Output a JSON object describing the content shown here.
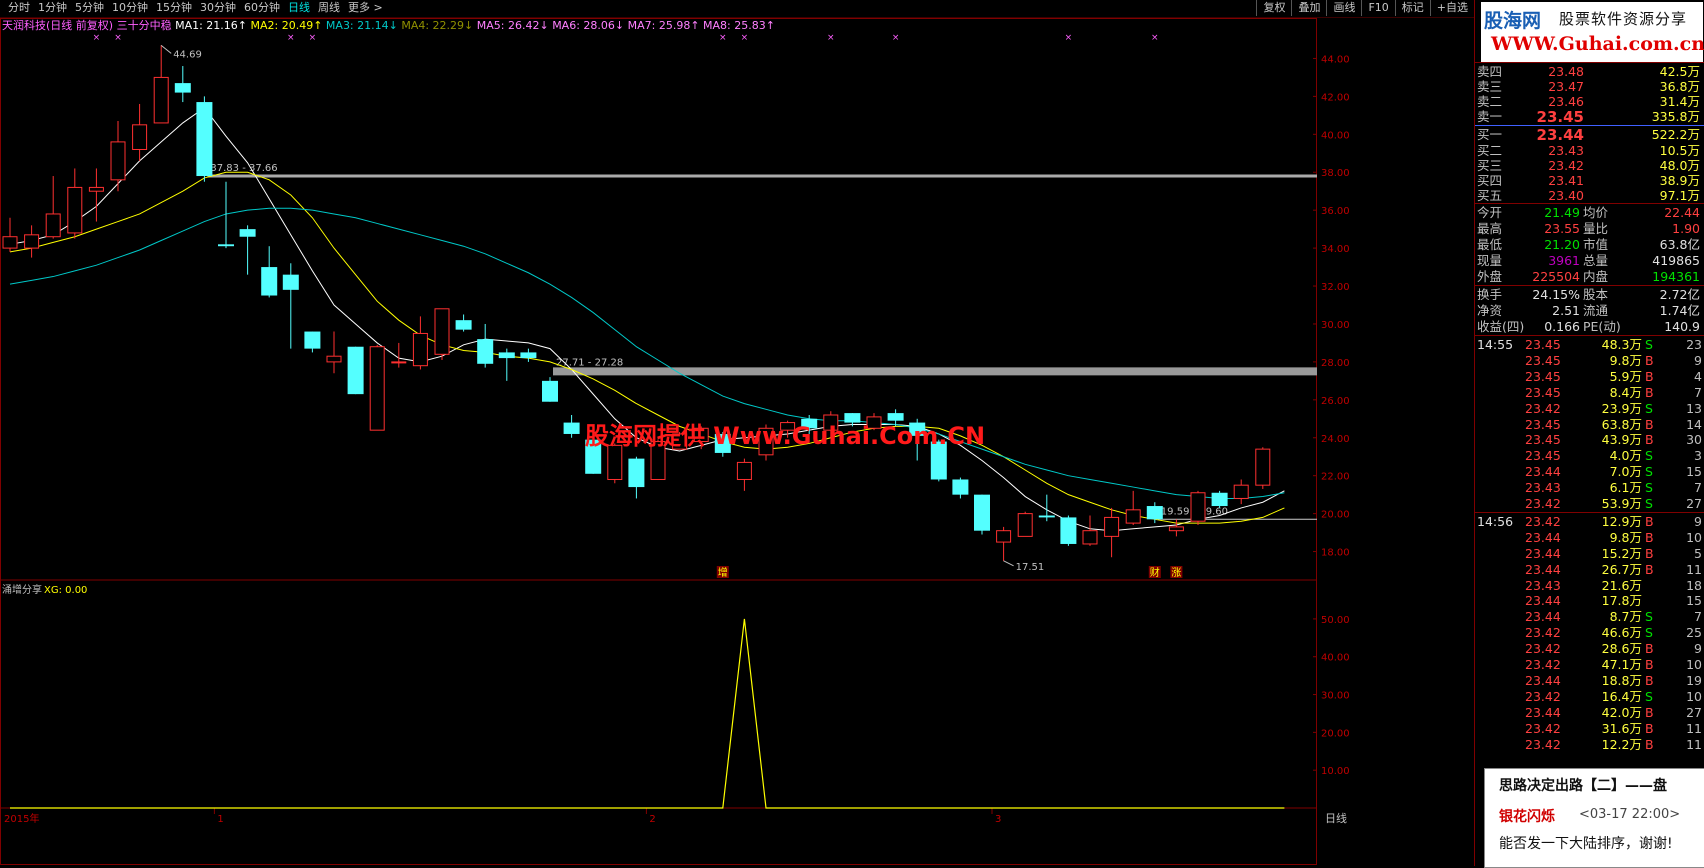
{
  "topbar": {
    "tabs": [
      "分时",
      "1分钟",
      "5分钟",
      "10分钟",
      "15分钟",
      "30分钟",
      "60分钟",
      "日线",
      "周线",
      "更多 >"
    ],
    "active": "日线",
    "right_buttons": [
      "复权",
      "叠加",
      "画线",
      "F10",
      "标记",
      "+自选"
    ]
  },
  "legend": {
    "title": "天润科技(日线 前复权) 三十分中稳",
    "ma": [
      {
        "name": "MA1",
        "value": "21.16",
        "arrow": "↑",
        "color": "#ffffff"
      },
      {
        "name": "MA2",
        "value": "20.49",
        "arrow": "↑",
        "color": "#ffff00"
      },
      {
        "name": "MA3",
        "value": "21.14",
        "arrow": "↓",
        "color": "#00c8c8"
      },
      {
        "name": "MA4",
        "value": "22.29",
        "arrow": "↓",
        "color": "#909000"
      },
      {
        "name": "MA5",
        "value": "26.42",
        "arrow": "↓",
        "color": "#ff80ff"
      },
      {
        "name": "MA6",
        "value": "28.06",
        "arrow": "↓",
        "color": "#ff80ff"
      },
      {
        "name": "MA7",
        "value": "25.98",
        "arrow": "↑",
        "color": "#ff80ff"
      },
      {
        "name": "MA8",
        "value": "25.83",
        "arrow": "↑",
        "color": "#ff80ff"
      }
    ]
  },
  "watermark": "股海网提供 Www.Guhai.Com.CN",
  "chart_data": [
    {
      "type": "candlestick",
      "ylim": [
        16.5,
        45.5
      ],
      "yticks": [
        "44.00",
        "42.00",
        "40.00",
        "38.00",
        "36.00",
        "34.00",
        "32.00",
        "30.00",
        "28.00",
        "26.00",
        "24.00",
        "22.00",
        "20.00",
        "18.00"
      ],
      "xtick_labels": [
        "2015年",
        "1",
        "2",
        "3"
      ],
      "xtick_index": [
        0,
        9,
        29,
        45
      ],
      "candles": [
        {
          "o": 34.0,
          "c": 34.6,
          "h": 35.6,
          "l": 33.8
        },
        {
          "o": 34.0,
          "c": 34.7,
          "h": 35.2,
          "l": 33.5
        },
        {
          "o": 34.6,
          "c": 35.8,
          "h": 37.8,
          "l": 34.5
        },
        {
          "o": 34.8,
          "c": 37.2,
          "h": 38.2,
          "l": 34.5
        },
        {
          "o": 37.0,
          "c": 37.2,
          "h": 38.2,
          "l": 35.4
        },
        {
          "o": 37.6,
          "c": 39.6,
          "h": 40.7,
          "l": 37.0
        },
        {
          "o": 39.2,
          "c": 40.5,
          "h": 41.6,
          "l": 38.6
        },
        {
          "o": 40.6,
          "c": 43.0,
          "h": 44.7,
          "l": 40.6
        },
        {
          "o": 42.7,
          "c": 42.2,
          "h": 43.6,
          "l": 41.7
        },
        {
          "o": 41.7,
          "c": 37.8,
          "h": 42.0,
          "l": 37.5
        },
        {
          "o": 34.2,
          "c": 34.1,
          "h": 37.5,
          "l": 34.0
        },
        {
          "o": 35.0,
          "c": 34.6,
          "h": 35.2,
          "l": 32.6
        },
        {
          "o": 33.0,
          "c": 31.5,
          "h": 34.1,
          "l": 31.4
        },
        {
          "o": 32.6,
          "c": 31.8,
          "h": 33.2,
          "l": 28.7
        },
        {
          "o": 29.6,
          "c": 28.7,
          "h": 29.6,
          "l": 28.5
        },
        {
          "o": 28.0,
          "c": 28.3,
          "h": 29.6,
          "l": 27.4
        },
        {
          "o": 28.8,
          "c": 26.3,
          "h": 28.8,
          "l": 26.3
        },
        {
          "o": 24.4,
          "c": 28.8,
          "h": 28.9,
          "l": 24.4
        },
        {
          "o": 28.0,
          "c": 28.0,
          "h": 29.0,
          "l": 27.7
        },
        {
          "o": 27.8,
          "c": 29.5,
          "h": 30.4,
          "l": 27.6
        },
        {
          "o": 28.4,
          "c": 30.8,
          "h": 30.8,
          "l": 28.1
        },
        {
          "o": 30.2,
          "c": 29.7,
          "h": 30.5,
          "l": 29.6
        },
        {
          "o": 29.2,
          "c": 27.9,
          "h": 30.0,
          "l": 27.7
        },
        {
          "o": 28.5,
          "c": 28.2,
          "h": 28.7,
          "l": 27.0
        },
        {
          "o": 28.5,
          "c": 28.2,
          "h": 28.7,
          "l": 28.0
        },
        {
          "o": 27.0,
          "c": 25.9,
          "h": 27.2,
          "l": 25.9
        },
        {
          "o": 24.8,
          "c": 24.2,
          "h": 25.2,
          "l": 24.0
        },
        {
          "o": 23.9,
          "c": 22.1,
          "h": 24.0,
          "l": 22.1
        },
        {
          "o": 21.8,
          "c": 23.6,
          "h": 23.7,
          "l": 21.6
        },
        {
          "o": 22.9,
          "c": 21.4,
          "h": 23.0,
          "l": 20.8
        },
        {
          "o": 21.8,
          "c": 23.8,
          "h": 23.9,
          "l": 21.8
        },
        {
          "o": 23.4,
          "c": 24.2,
          "h": 24.3,
          "l": 23.4
        },
        {
          "o": 23.8,
          "c": 24.5,
          "h": 24.6,
          "l": 23.4
        },
        {
          "o": 24.2,
          "c": 23.2,
          "h": 24.3,
          "l": 23.0
        },
        {
          "o": 21.8,
          "c": 22.7,
          "h": 22.9,
          "l": 21.2
        },
        {
          "o": 23.1,
          "c": 24.5,
          "h": 24.7,
          "l": 22.8
        },
        {
          "o": 24.4,
          "c": 24.8,
          "h": 24.9,
          "l": 24.0
        },
        {
          "o": 25.0,
          "c": 24.5,
          "h": 25.2,
          "l": 24.2
        },
        {
          "o": 24.4,
          "c": 25.2,
          "h": 25.4,
          "l": 24.0
        },
        {
          "o": 25.3,
          "c": 24.8,
          "h": 25.3,
          "l": 24.6
        },
        {
          "o": 24.5,
          "c": 25.1,
          "h": 25.3,
          "l": 24.4
        },
        {
          "o": 25.3,
          "c": 24.9,
          "h": 25.5,
          "l": 24.6
        },
        {
          "o": 24.8,
          "c": 24.1,
          "h": 25.0,
          "l": 22.8
        },
        {
          "o": 23.8,
          "c": 21.8,
          "h": 23.9,
          "l": 21.7
        },
        {
          "o": 21.8,
          "c": 21.0,
          "h": 21.9,
          "l": 20.8
        },
        {
          "o": 21.0,
          "c": 19.1,
          "h": 21.0,
          "l": 18.9
        },
        {
          "o": 18.5,
          "c": 19.1,
          "h": 19.3,
          "l": 17.5
        },
        {
          "o": 18.8,
          "c": 20.0,
          "h": 20.1,
          "l": 18.8
        },
        {
          "o": 19.9,
          "c": 19.8,
          "h": 21.0,
          "l": 19.6
        },
        {
          "o": 19.8,
          "c": 18.4,
          "h": 19.9,
          "l": 18.3
        },
        {
          "o": 18.4,
          "c": 19.1,
          "h": 19.9,
          "l": 18.3
        },
        {
          "o": 18.8,
          "c": 19.8,
          "h": 20.3,
          "l": 17.7
        },
        {
          "o": 19.5,
          "c": 20.2,
          "h": 21.2,
          "l": 19.4
        },
        {
          "o": 20.4,
          "c": 19.7,
          "h": 20.6,
          "l": 19.5
        },
        {
          "o": 19.1,
          "c": 19.3,
          "h": 19.7,
          "l": 18.8
        },
        {
          "o": 19.6,
          "c": 21.1,
          "h": 21.2,
          "l": 19.4
        },
        {
          "o": 21.1,
          "c": 20.4,
          "h": 21.2,
          "l": 20.3
        },
        {
          "o": 20.8,
          "c": 21.5,
          "h": 21.8,
          "l": 20.5
        },
        {
          "o": 21.5,
          "c": 23.4,
          "h": 23.5,
          "l": 21.3
        }
      ],
      "ma_lines": [
        {
          "name": "MA1",
          "color": "#ffffff",
          "values": [
            34.2,
            34.4,
            34.7,
            35.4,
            36.2,
            37.4,
            38.6,
            39.6,
            40.6,
            41.4,
            39.9,
            38.5,
            36.6,
            34.7,
            32.8,
            31.0,
            30.0,
            29.0,
            28.2,
            28.0,
            28.3,
            28.9,
            29.2,
            29.1,
            29.0,
            28.7,
            27.6,
            26.3,
            25.0,
            24.0,
            23.5,
            23.3,
            23.6,
            23.9,
            24.0,
            24.1,
            24.2,
            24.4,
            24.6,
            24.7,
            24.7,
            24.7,
            24.6,
            24.2,
            23.6,
            22.8,
            21.9,
            20.9,
            20.2,
            19.6,
            19.2,
            19.1,
            19.2,
            19.3,
            19.4,
            19.7,
            19.9,
            20.3,
            20.6,
            21.2
          ]
        },
        {
          "name": "MA2",
          "color": "#ffff00",
          "values": [
            33.8,
            34.0,
            34.3,
            34.6,
            35.0,
            35.4,
            35.8,
            36.4,
            37.0,
            37.7,
            38.0,
            38.0,
            37.6,
            36.8,
            35.6,
            34.0,
            32.6,
            31.2,
            30.2,
            29.4,
            28.9,
            28.6,
            28.5,
            28.3,
            28.2,
            28.0,
            27.6,
            27.1,
            26.5,
            25.8,
            25.2,
            24.6,
            24.2,
            23.8,
            23.5,
            23.4,
            23.5,
            23.7,
            24.0,
            24.3,
            24.5,
            24.6,
            24.6,
            24.5,
            24.1,
            23.6,
            23.0,
            22.3,
            21.6,
            21.0,
            20.6,
            20.2,
            19.9,
            19.7,
            19.5,
            19.5,
            19.5,
            19.6,
            19.8,
            20.3
          ]
        },
        {
          "name": "MA3",
          "color": "#00c8c8",
          "values": [
            32.1,
            32.3,
            32.5,
            32.8,
            33.1,
            33.5,
            33.9,
            34.4,
            34.9,
            35.4,
            35.8,
            36.0,
            36.1,
            36.1,
            36.0,
            35.8,
            35.6,
            35.3,
            35.0,
            34.7,
            34.4,
            34.1,
            33.7,
            33.2,
            32.7,
            32.1,
            31.4,
            30.6,
            29.7,
            28.8,
            28.1,
            27.4,
            26.8,
            26.2,
            25.8,
            25.5,
            25.2,
            25.0,
            24.9,
            24.9,
            24.8,
            24.7,
            24.5,
            24.2,
            23.8,
            23.4,
            23.0,
            22.6,
            22.3,
            22.0,
            21.8,
            21.6,
            21.4,
            21.2,
            21.0,
            20.9,
            20.8,
            20.8,
            20.9,
            21.1
          ]
        }
      ],
      "guide_lines": [
        {
          "value": 37.8,
          "from_index": 9,
          "label": "37.83 - 37.66",
          "color": "#aaaaaa"
        },
        {
          "value": 27.5,
          "from_index": 25,
          "label": "27.71 - 27.28",
          "color": "#999999"
        },
        {
          "value": 19.7,
          "from_index": 53,
          "label": "19.59 - 19.60",
          "color": "#cccccc"
        }
      ],
      "annotations": [
        {
          "index": 7,
          "value": 44.69,
          "label": "44.69"
        },
        {
          "index": 46,
          "value": 17.51,
          "label": "17.51"
        }
      ],
      "markers": [
        {
          "index": 33,
          "label": "增"
        },
        {
          "index": 53,
          "label": "财"
        },
        {
          "index": 54,
          "label": "涨"
        }
      ],
      "star_indices": [
        4,
        5,
        13,
        14,
        33,
        34,
        38,
        41,
        49,
        53
      ]
    },
    {
      "type": "line",
      "title": "涌增分享",
      "series_label": "XG: 0.00",
      "ylim": [
        0,
        55
      ],
      "yticks": [
        "50.00",
        "40.00",
        "30.00",
        "20.00",
        "10.00"
      ],
      "xlabel": "日线",
      "series": [
        {
          "name": "XG",
          "color": "#ffff00",
          "values": [
            0,
            0,
            0,
            0,
            0,
            0,
            0,
            0,
            0,
            0,
            0,
            0,
            0,
            0,
            0,
            0,
            0,
            0,
            0,
            0,
            0,
            0,
            0,
            0,
            0,
            0,
            0,
            0,
            0,
            0,
            0,
            0,
            0,
            0,
            50,
            0,
            0,
            0,
            0,
            0,
            0,
            0,
            0,
            0,
            0,
            0,
            0,
            0,
            0,
            0,
            0,
            0,
            0,
            0,
            0,
            0,
            0,
            0,
            0,
            0
          ]
        }
      ]
    }
  ],
  "quote": {
    "logo": {
      "name": "股海网",
      "slogan": "股票软件资源分享",
      "site": "WWW.Guhai.com.cn"
    },
    "sells": [
      {
        "label": "卖四",
        "price": "23.48",
        "vol": "42.5万"
      },
      {
        "label": "卖三",
        "price": "23.47",
        "vol": "36.8万"
      },
      {
        "label": "卖二",
        "price": "23.46",
        "vol": "31.4万"
      },
      {
        "label": "卖一",
        "price": "23.45",
        "vol": "335.8万"
      }
    ],
    "buys": [
      {
        "label": "买一",
        "price": "23.44",
        "vol": "522.2万"
      },
      {
        "label": "买二",
        "price": "23.43",
        "vol": "10.5万"
      },
      {
        "label": "买三",
        "price": "23.42",
        "vol": "48.0万"
      },
      {
        "label": "买四",
        "price": "23.41",
        "vol": "38.9万"
      },
      {
        "label": "买五",
        "price": "23.40",
        "vol": "97.1万"
      }
    ],
    "stats": [
      {
        "l1": "今开",
        "v1": "21.49",
        "c1": "#00e000",
        "l2": "均价",
        "v2": "22.44",
        "c2": "#ff4040"
      },
      {
        "l1": "最高",
        "v1": "23.55",
        "c1": "#ff4040",
        "l2": "量比",
        "v2": "1.90",
        "c2": "#ff4040"
      },
      {
        "l1": "最低",
        "v1": "21.20",
        "c1": "#00e000",
        "l2": "市值",
        "v2": "63.8亿",
        "c2": "#e0e0e0"
      },
      {
        "l1": "现量",
        "v1": "3961",
        "c1": "#c000c0",
        "l2": "总量",
        "v2": "419865",
        "c2": "#e0e0e0"
      },
      {
        "l1": "外盘",
        "v1": "225504",
        "c1": "#ff4040",
        "l2": "内盘",
        "v2": "194361",
        "c2": "#00e000"
      }
    ],
    "stats2": [
      {
        "l1": "换手",
        "v1": "24.15%",
        "l2": "股本",
        "v2": "2.72亿"
      },
      {
        "l1": "净资",
        "v1": "2.51",
        "l2": "流通",
        "v2": "1.74亿"
      },
      {
        "l1": "收益(四)",
        "v1": "0.166",
        "l2": "PE(动)",
        "v2": "140.9"
      }
    ],
    "ticks": [
      {
        "t": "14:55",
        "p": "23.45",
        "v": "48.3万",
        "s": "S",
        "n": "23"
      },
      {
        "t": "",
        "p": "23.45",
        "v": "9.8万",
        "s": "B",
        "n": "9"
      },
      {
        "t": "",
        "p": "23.45",
        "v": "5.9万",
        "s": "B",
        "n": "4"
      },
      {
        "t": "",
        "p": "23.45",
        "v": "8.4万",
        "s": "B",
        "n": "7"
      },
      {
        "t": "",
        "p": "23.42",
        "v": "23.9万",
        "s": "S",
        "n": "13"
      },
      {
        "t": "",
        "p": "23.45",
        "v": "63.8万",
        "s": "B",
        "n": "14"
      },
      {
        "t": "",
        "p": "23.45",
        "v": "43.9万",
        "s": "B",
        "n": "30"
      },
      {
        "t": "",
        "p": "23.45",
        "v": "4.0万",
        "s": "S",
        "n": "3"
      },
      {
        "t": "",
        "p": "23.44",
        "v": "7.0万",
        "s": "S",
        "n": "15"
      },
      {
        "t": "",
        "p": "23.43",
        "v": "6.1万",
        "s": "S",
        "n": "7"
      },
      {
        "t": "",
        "p": "23.42",
        "v": "53.9万",
        "s": "S",
        "n": "27"
      },
      {
        "t": "14:56",
        "p": "23.42",
        "v": "12.9万",
        "s": "B",
        "n": "9"
      },
      {
        "t": "",
        "p": "23.44",
        "v": "9.8万",
        "s": "B",
        "n": "10"
      },
      {
        "t": "",
        "p": "23.44",
        "v": "15.2万",
        "s": "B",
        "n": "5"
      },
      {
        "t": "",
        "p": "23.44",
        "v": "26.7万",
        "s": "B",
        "n": "11"
      },
      {
        "t": "",
        "p": "23.43",
        "v": "21.6万",
        "s": "",
        "n": "18"
      },
      {
        "t": "",
        "p": "23.44",
        "v": "17.8万",
        "s": "",
        "n": "15"
      },
      {
        "t": "",
        "p": "23.44",
        "v": "8.7万",
        "s": "S",
        "n": "7"
      },
      {
        "t": "",
        "p": "23.42",
        "v": "46.6万",
        "s": "S",
        "n": "25"
      },
      {
        "t": "",
        "p": "23.42",
        "v": "28.6万",
        "s": "B",
        "n": "9"
      },
      {
        "t": "",
        "p": "23.42",
        "v": "47.1万",
        "s": "B",
        "n": "10"
      },
      {
        "t": "",
        "p": "23.44",
        "v": "18.8万",
        "s": "B",
        "n": "19"
      },
      {
        "t": "",
        "p": "23.42",
        "v": "16.4万",
        "s": "S",
        "n": "10"
      },
      {
        "t": "",
        "p": "23.44",
        "v": "42.0万",
        "s": "B",
        "n": "27"
      },
      {
        "t": "",
        "p": "23.42",
        "v": "31.6万",
        "s": "B",
        "n": "11"
      },
      {
        "t": "",
        "p": "23.42",
        "v": "12.2万",
        "s": "B",
        "n": "11"
      }
    ]
  },
  "popup": {
    "title": "思路决定出路【二】——盘",
    "user": "银花闪烁",
    "time": "<03-17 22:00>",
    "message": "能否发一下大陆排序，谢谢!"
  }
}
